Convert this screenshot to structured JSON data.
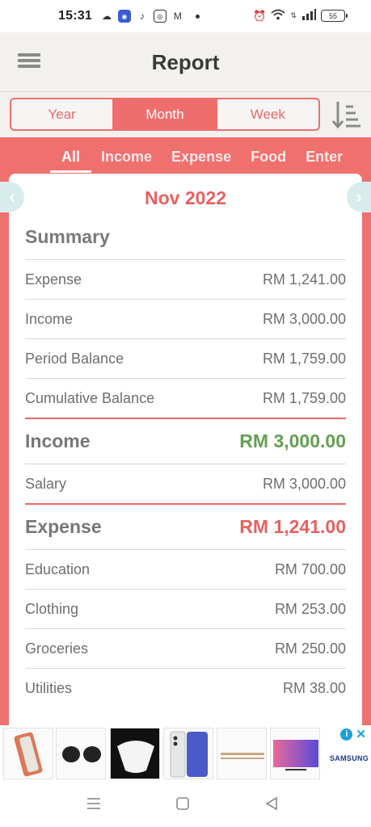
{
  "status_bar": {
    "time": "15:31",
    "battery": "55"
  },
  "header": {
    "title": "Report",
    "menu_icon": "hamburger-menu-icon",
    "sort_icon": "sort-descending-icon"
  },
  "period_tabs": [
    {
      "label": "Year",
      "active": false
    },
    {
      "label": "Month",
      "active": true
    },
    {
      "label": "Week",
      "active": false
    }
  ],
  "category_tabs": [
    {
      "label": "All",
      "active": true
    },
    {
      "label": "Income",
      "active": false
    },
    {
      "label": "Expense",
      "active": false
    },
    {
      "label": "Food",
      "active": false
    },
    {
      "label": "Enter",
      "active": false
    }
  ],
  "report": {
    "month": "Nov 2022",
    "summary": {
      "heading": "Summary",
      "rows": [
        {
          "label": "Expense",
          "value": "RM 1,241.00"
        },
        {
          "label": "Income",
          "value": "RM 3,000.00"
        },
        {
          "label": "Period Balance",
          "value": "RM 1,759.00"
        },
        {
          "label": "Cumulative Balance",
          "value": "RM 1,759.00"
        }
      ]
    },
    "income": {
      "heading": "Income",
      "total": "RM 3,000.00",
      "rows": [
        {
          "label": "Salary",
          "value": "RM 3,000.00"
        }
      ]
    },
    "expense": {
      "heading": "Expense",
      "total": "RM 1,241.00",
      "rows": [
        {
          "label": "Education",
          "value": "RM 700.00"
        },
        {
          "label": "Clothing",
          "value": "RM 253.00"
        },
        {
          "label": "Groceries",
          "value": "RM 250.00"
        },
        {
          "label": "Utilities",
          "value": "RM 38.00"
        }
      ]
    }
  },
  "ad": {
    "brand": "SAMSUNG"
  },
  "colors": {
    "accent": "#ee6e6e",
    "income_green": "#64a050",
    "expense_red": "#e8615f"
  }
}
